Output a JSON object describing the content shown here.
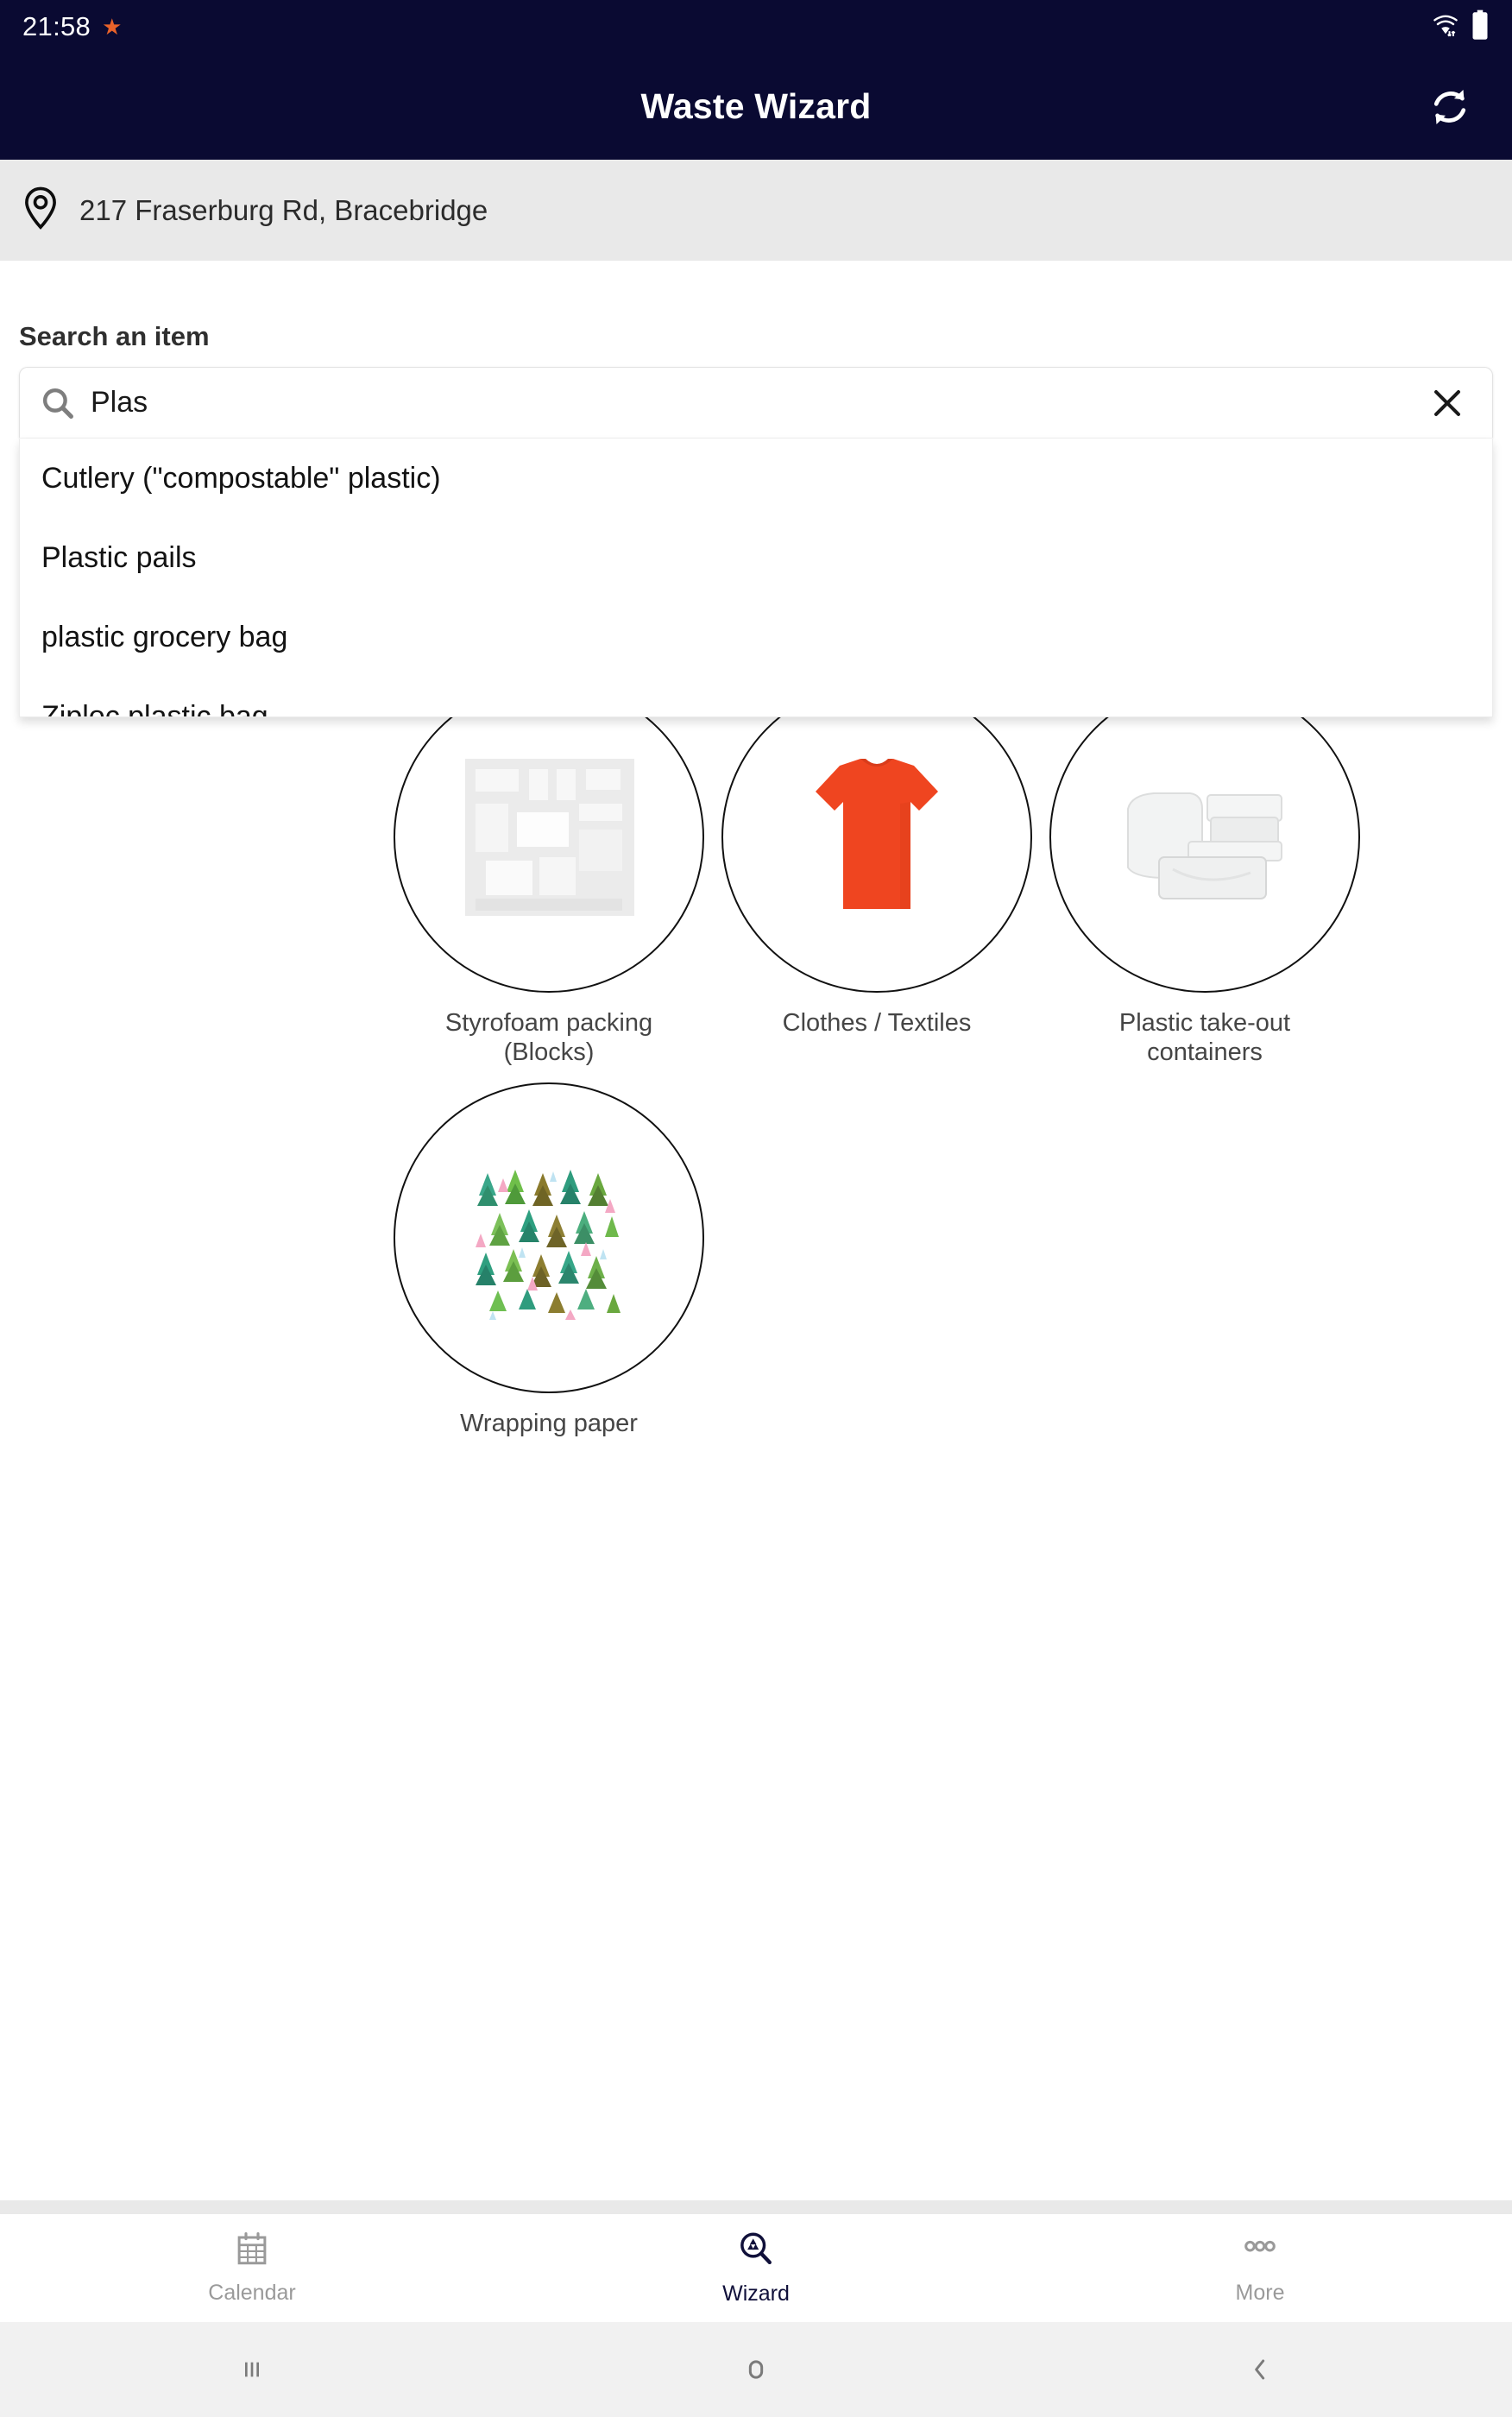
{
  "status_bar": {
    "time": "21:58",
    "star_icon": "star-icon",
    "wifi_icon": "wifi-icon",
    "battery_icon": "battery-full-icon"
  },
  "app_bar": {
    "title": "Waste Wizard",
    "refresh_icon": "refresh-icon",
    "background_color": "#0a0a32"
  },
  "address_bar": {
    "pin_icon": "location-pin-icon",
    "address": "217 Fraserburg Rd, Bracebridge",
    "background_color": "#e9e9e9"
  },
  "search": {
    "label": "Search an item",
    "value": "Plas",
    "placeholder": "Search an item",
    "search_icon": "search-icon",
    "clear_icon": "close-icon"
  },
  "suggestions": [
    {
      "label": "Cutlery (\"compostable\" plastic)"
    },
    {
      "label": "Plastic pails"
    },
    {
      "label": "plastic grocery bag"
    },
    {
      "label": "Ziploc plastic bag"
    }
  ],
  "results": [
    {
      "label": "Styrofoam packing (Blocks)",
      "image": "styrofoam-block-image"
    },
    {
      "label": "Clothes / Textiles",
      "image": "orange-tshirt-image"
    },
    {
      "label": "Plastic take-out containers",
      "image": "clear-containers-image"
    },
    {
      "label": "Wrapping paper",
      "image": "tree-pattern-wrapping-paper-image"
    }
  ],
  "bottom_nav": {
    "active": "Wizard",
    "items": [
      {
        "label": "Calendar",
        "icon": "calendar-icon",
        "active": false
      },
      {
        "label": "Wizard",
        "icon": "recycle-magnifier-icon",
        "active": true
      },
      {
        "label": "More",
        "icon": "more-dots-icon",
        "active": false
      }
    ],
    "active_color": "#10103a",
    "inactive_color": "#9a9a9a"
  },
  "system_nav": {
    "recents_icon": "recent-apps-icon",
    "home_icon": "home-icon",
    "back_icon": "back-icon"
  }
}
